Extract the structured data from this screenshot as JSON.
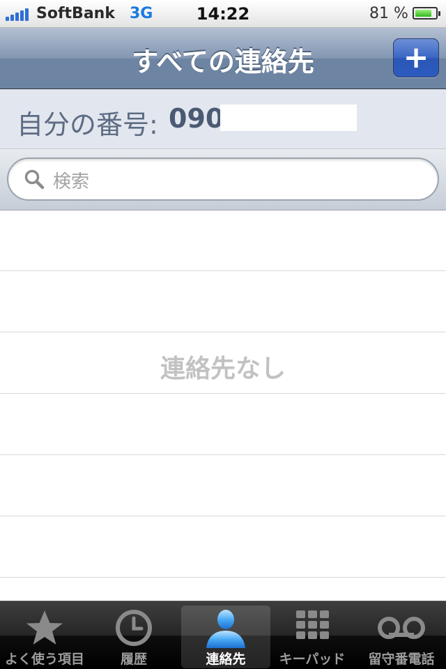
{
  "status_bar": {
    "carrier": "SoftBank",
    "network": "3G",
    "time": "14:22",
    "battery_percent": "81 %",
    "battery_level": 0.81,
    "signal_bars": 5
  },
  "nav": {
    "title": "すべての連絡先",
    "add_button_label": "+"
  },
  "my_number": {
    "label": "自分の番号:",
    "value": "090"
  },
  "search": {
    "placeholder": "検索",
    "icon": "search-icon"
  },
  "contacts": {
    "empty_message": "連絡先なし"
  },
  "tabs": [
    {
      "label": "よく使う項目",
      "icon": "star-icon",
      "active": false
    },
    {
      "label": "履歴",
      "icon": "clock-icon",
      "active": false
    },
    {
      "label": "連絡先",
      "icon": "person-icon",
      "active": true
    },
    {
      "label": "キーパッド",
      "icon": "keypad-icon",
      "active": false
    },
    {
      "label": "留守番電話",
      "icon": "voicemail-icon",
      "active": false
    }
  ],
  "colors": {
    "nav_bar": "#7d91ae",
    "add_button": "#3a67c4",
    "active_tab_icon": "#3fa0f0",
    "signal": "#2f6fd6",
    "battery_fill": "#2fb81c"
  }
}
